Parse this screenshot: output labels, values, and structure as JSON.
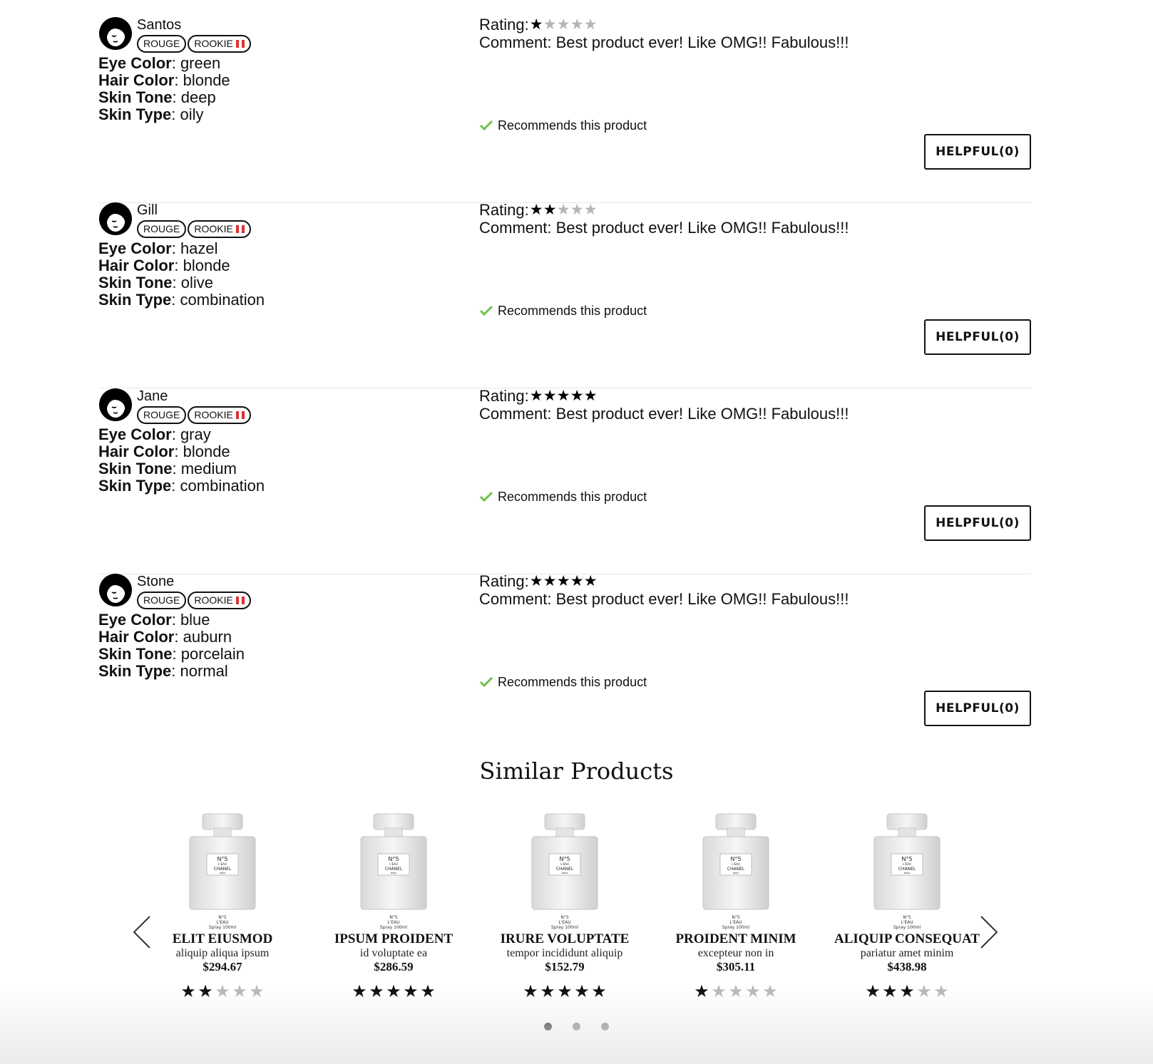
{
  "reviews": [
    {
      "name": "Santos",
      "badges": [
        "ROUGE",
        "ROOKIE"
      ],
      "attributes": [
        {
          "label": "Eye Color",
          "value": "green"
        },
        {
          "label": "Hair Color",
          "value": "blonde"
        },
        {
          "label": "Skin Tone",
          "value": "deep"
        },
        {
          "label": "Skin Type",
          "value": "oily"
        }
      ],
      "rating_label": "Rating:",
      "rating": 1,
      "comment": "Comment: Best product ever! Like OMG!! Fabulous!!!",
      "recommends": "Recommends this product",
      "helpful_label": "HELPFUL(0)"
    },
    {
      "name": "Gill",
      "badges": [
        "ROUGE",
        "ROOKIE"
      ],
      "attributes": [
        {
          "label": "Eye Color",
          "value": "hazel"
        },
        {
          "label": "Hair Color",
          "value": "blonde"
        },
        {
          "label": "Skin Tone",
          "value": "olive"
        },
        {
          "label": "Skin Type",
          "value": "combination"
        }
      ],
      "rating_label": "Rating:",
      "rating": 2,
      "comment": "Comment: Best product ever! Like OMG!! Fabulous!!!",
      "recommends": "Recommends this product",
      "helpful_label": "HELPFUL(0)"
    },
    {
      "name": "Jane",
      "badges": [
        "ROUGE",
        "ROOKIE"
      ],
      "attributes": [
        {
          "label": "Eye Color",
          "value": "gray"
        },
        {
          "label": "Hair Color",
          "value": "blonde"
        },
        {
          "label": "Skin Tone",
          "value": "medium"
        },
        {
          "label": "Skin Type",
          "value": "combination"
        }
      ],
      "rating_label": "Rating:",
      "rating": 5,
      "comment": "Comment: Best product ever! Like OMG!! Fabulous!!!",
      "recommends": "Recommends this product",
      "helpful_label": "HELPFUL(0)"
    },
    {
      "name": "Stone",
      "badges": [
        "ROUGE",
        "ROOKIE"
      ],
      "attributes": [
        {
          "label": "Eye Color",
          "value": "blue"
        },
        {
          "label": "Hair Color",
          "value": "auburn"
        },
        {
          "label": "Skin Tone",
          "value": "porcelain"
        },
        {
          "label": "Skin Type",
          "value": "normal"
        }
      ],
      "rating_label": "Rating:",
      "rating": 5,
      "comment": "Comment: Best product ever! Like OMG!! Fabulous!!!",
      "recommends": "Recommends this product",
      "helpful_label": "HELPFUL(0)"
    }
  ],
  "similar": {
    "title": "Similar Products",
    "bottle_caption": [
      "N°5",
      "L'EAU",
      "Spray 100ml"
    ],
    "bottle_label": [
      "N°5",
      "L'EAU",
      "CHANEL",
      "PARIS"
    ],
    "products": [
      {
        "name": "ELIT EIUSMOD",
        "desc": "aliquip aliqua ipsum",
        "price": "$294.67",
        "rating": 2
      },
      {
        "name": "IPSUM PROIDENT",
        "desc": "id voluptate ea",
        "price": "$286.59",
        "rating": 5
      },
      {
        "name": "IRURE VOLUPTATE",
        "desc": "tempor incididunt aliquip",
        "price": "$152.79",
        "rating": 5
      },
      {
        "name": "PROIDENT MINIM",
        "desc": "excepteur non in",
        "price": "$305.11",
        "rating": 1
      },
      {
        "name": "ALIQUIP CONSEQUAT",
        "desc": "pariatur amet minim",
        "price": "$438.98",
        "rating": 3
      }
    ],
    "pages": 3,
    "active_page": 0
  },
  "colors": {
    "check_green": "#6cc24a",
    "star_on": "#000000",
    "star_off": "#b5b5b5",
    "flag_red": "#e03030"
  },
  "icons": {
    "avatar": "woman-face-icon",
    "recommend": "checkmark-icon",
    "prev": "chevron-left-icon",
    "next": "chevron-right-icon",
    "star": "star-icon"
  }
}
